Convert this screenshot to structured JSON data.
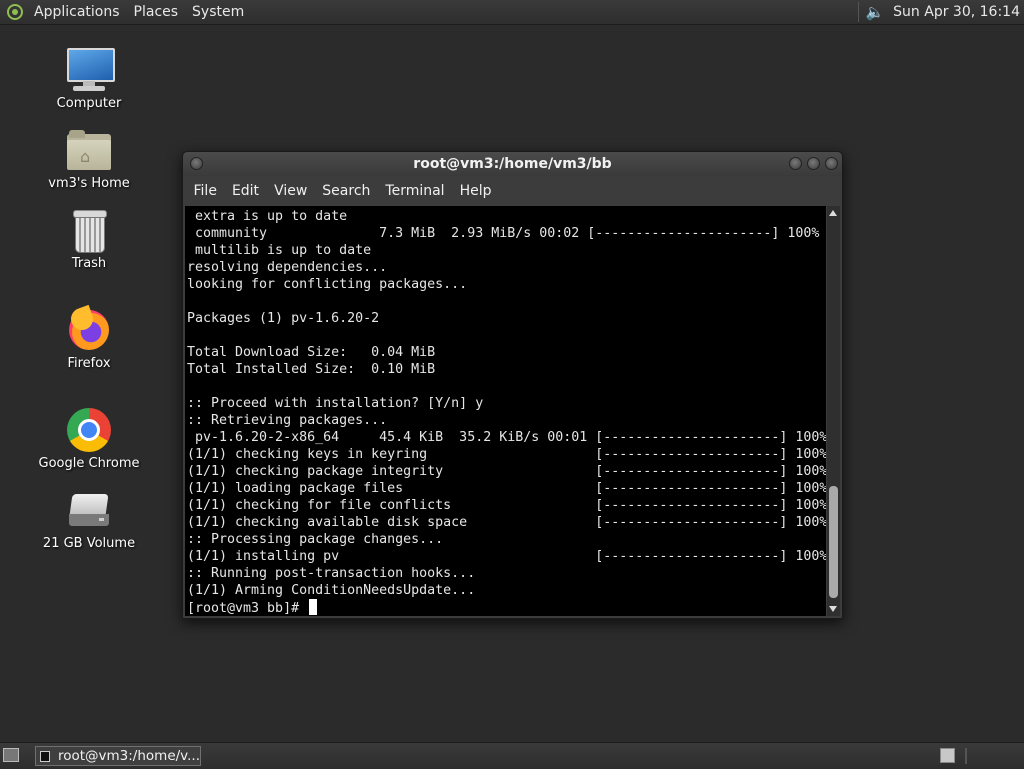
{
  "top_panel": {
    "menus": [
      "Applications",
      "Places",
      "System"
    ],
    "clock": "Sun Apr 30, 16:14"
  },
  "desktop_icons": [
    {
      "label": "Computer",
      "icon": "computer-icon"
    },
    {
      "label": "vm3's Home",
      "icon": "home-folder-icon"
    },
    {
      "label": "Trash",
      "icon": "trash-icon"
    },
    {
      "label": "Firefox",
      "icon": "firefox-icon"
    },
    {
      "label": "Google Chrome",
      "icon": "chrome-icon"
    },
    {
      "label": "21 GB Volume",
      "icon": "drive-icon"
    }
  ],
  "terminal": {
    "title": "root@vm3:/home/vm3/bb",
    "menus": [
      "File",
      "Edit",
      "View",
      "Search",
      "Terminal",
      "Help"
    ],
    "lines": [
      " extra is up to date",
      " community              7.3 MiB  2.93 MiB/s 00:02 [----------------------] 100%",
      " multilib is up to date",
      "resolving dependencies...",
      "looking for conflicting packages...",
      "",
      "Packages (1) pv-1.6.20-2",
      "",
      "Total Download Size:   0.04 MiB",
      "Total Installed Size:  0.10 MiB",
      "",
      ":: Proceed with installation? [Y/n] y",
      ":: Retrieving packages...",
      " pv-1.6.20-2-x86_64     45.4 KiB  35.2 KiB/s 00:01 [----------------------] 100%",
      "(1/1) checking keys in keyring                     [----------------------] 100%",
      "(1/1) checking package integrity                   [----------------------] 100%",
      "(1/1) loading package files                        [----------------------] 100%",
      "(1/1) checking for file conflicts                  [----------------------] 100%",
      "(1/1) checking available disk space                [----------------------] 100%",
      ":: Processing package changes...",
      "(1/1) installing pv                                [----------------------] 100%",
      ":: Running post-transaction hooks...",
      "(1/1) Arming ConditionNeedsUpdate..."
    ],
    "prompt": "[root@vm3 bb]# "
  },
  "taskbar": {
    "task_label": "root@vm3:/home/v..."
  },
  "colors": {
    "desktop_bg": "#2b2b2b",
    "terminal_bg": "#000000",
    "terminal_fg": "#e6e6e6",
    "panel_bg": "#333333"
  }
}
